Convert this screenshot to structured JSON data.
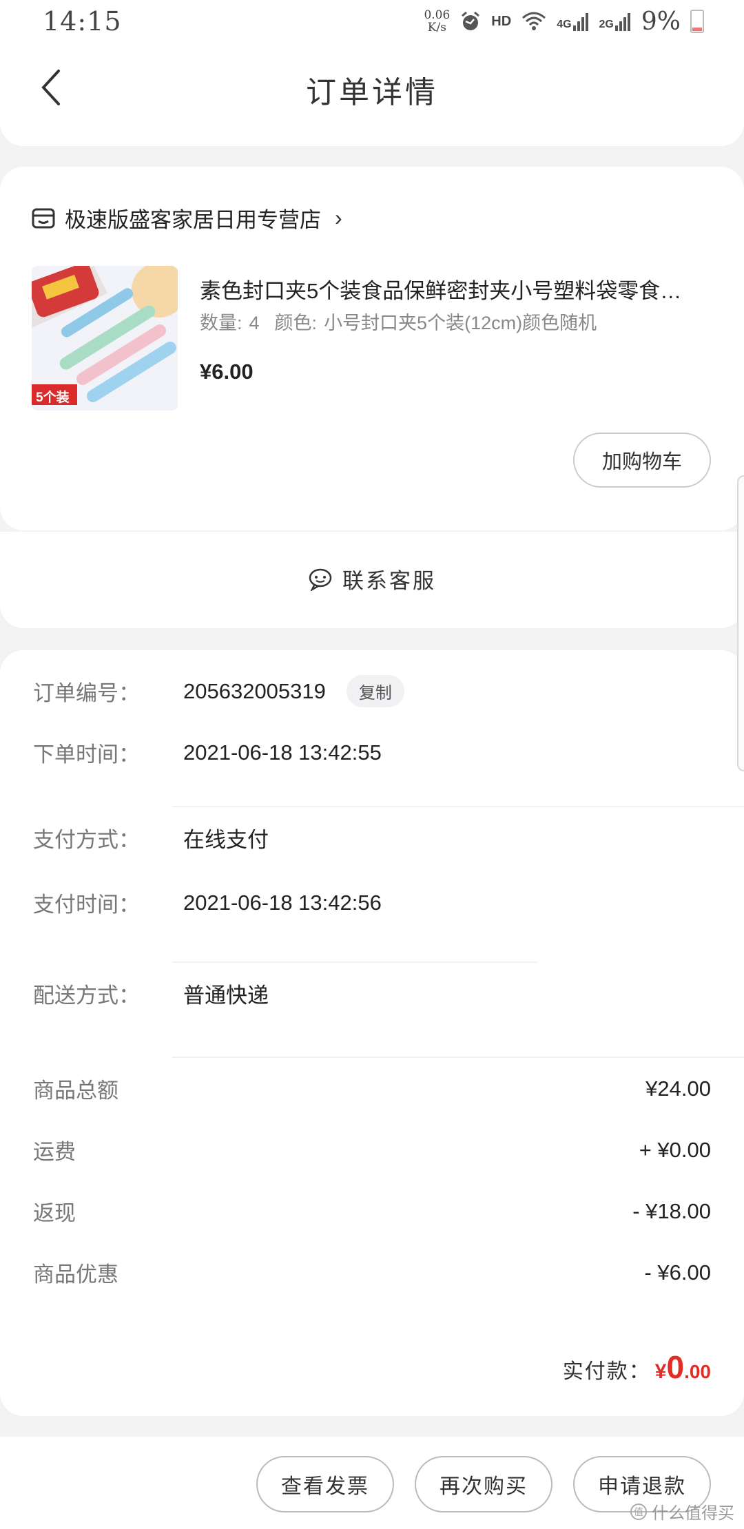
{
  "status_bar": {
    "time": "14:15",
    "net_speed_value": "0.06",
    "net_speed_unit": "K/s",
    "hd": "HD",
    "net_4g": "4G",
    "net_2g": "2G",
    "battery": "9%"
  },
  "header": {
    "title": "订单详情"
  },
  "store": {
    "name": "极速版盛客家居日用专营店",
    "chevron": "›"
  },
  "product": {
    "title": "素色封口夹5个装食品保鲜密封夹小号塑料袋零食…",
    "quantity_label": "数量:",
    "quantity": "4",
    "color_label": "颜色:",
    "color": "小号封口夹5个装(12cm)颜色随机",
    "price": "¥6.00",
    "thumb_badge": "5个装",
    "add_cart_label": "加购物车"
  },
  "customer_service": {
    "label": "联系客服"
  },
  "order_info": {
    "order_no_label": "订单编号：",
    "order_no": "205632005319",
    "copy_label": "复制",
    "order_time_label": "下单时间：",
    "order_time": "2021-06-18 13:42:55",
    "pay_method_label": "支付方式：",
    "pay_method": "在线支付",
    "pay_time_label": "支付时间：",
    "pay_time": "2021-06-18 13:42:56",
    "delivery_label": "配送方式：",
    "delivery": "普通快递"
  },
  "amounts": [
    {
      "label": "商品总额",
      "value": "¥24.00"
    },
    {
      "label": "运费",
      "value": "+ ¥0.00"
    },
    {
      "label": "返现",
      "value": "- ¥18.00"
    },
    {
      "label": "商品优惠",
      "value": "- ¥6.00"
    }
  ],
  "total": {
    "label": "实付款：",
    "currency": "¥",
    "integer": "0",
    "decimal": ".00"
  },
  "bottom_actions": {
    "invoice": "查看发票",
    "rebuy": "再次购买",
    "refund": "申请退款"
  },
  "watermark": "什么值得买",
  "colors": {
    "accent_red": "#e02e24",
    "background": "#f3f3f3"
  }
}
